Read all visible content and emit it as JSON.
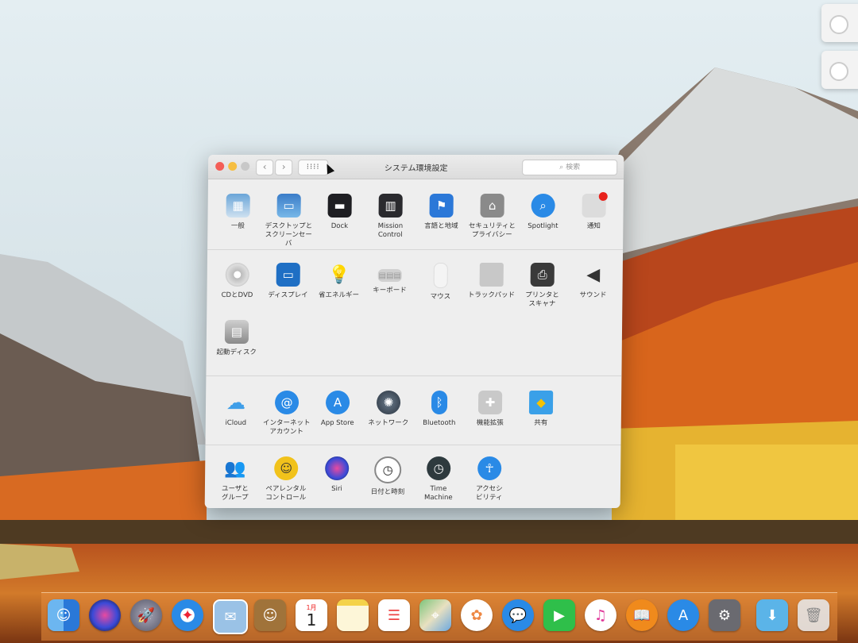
{
  "window": {
    "title": "システム環境設定",
    "search_placeholder": "検索",
    "back_label": "‹",
    "forward_label": "›",
    "grid_label": "⁝⁝⁝⁝"
  },
  "sections": {
    "personal": [
      {
        "label": "一般",
        "icon": "general-icon"
      },
      {
        "label": "デスクトップと\nスクリーンセーバ",
        "icon": "desktop-icon"
      },
      {
        "label": "Dock",
        "icon": "dock-icon"
      },
      {
        "label": "Mission\nControl",
        "icon": "mission-control-icon"
      },
      {
        "label": "言語と地域",
        "icon": "language-icon"
      },
      {
        "label": "セキュリティと\nプライバシー",
        "icon": "security-icon"
      },
      {
        "label": "Spotlight",
        "icon": "spotlight-icon"
      },
      {
        "label": "通知",
        "icon": "notifications-icon"
      }
    ],
    "hardware": [
      {
        "label": "CDとDVD",
        "icon": "cd-dvd-icon"
      },
      {
        "label": "ディスプレイ",
        "icon": "display-icon"
      },
      {
        "label": "省エネルギー",
        "icon": "energy-icon"
      },
      {
        "label": "キーボード",
        "icon": "keyboard-icon"
      },
      {
        "label": "マウス",
        "icon": "mouse-icon"
      },
      {
        "label": "トラックパッド",
        "icon": "trackpad-icon"
      },
      {
        "label": "プリンタと\nスキャナ",
        "icon": "printer-icon"
      },
      {
        "label": "サウンド",
        "icon": "sound-icon"
      },
      {
        "label": "起動ディスク",
        "icon": "startup-disk-icon"
      }
    ],
    "internet": [
      {
        "label": "iCloud",
        "icon": "icloud-icon"
      },
      {
        "label": "インターネット\nアカウント",
        "icon": "internet-accounts-icon"
      },
      {
        "label": "App Store",
        "icon": "app-store-icon"
      },
      {
        "label": "ネットワーク",
        "icon": "network-icon"
      },
      {
        "label": "Bluetooth",
        "icon": "bluetooth-icon"
      },
      {
        "label": "機能拡張",
        "icon": "extensions-icon"
      },
      {
        "label": "共有",
        "icon": "sharing-icon"
      }
    ],
    "system": [
      {
        "label": "ユーザと\nグループ",
        "icon": "users-icon"
      },
      {
        "label": "ペアレンタル\nコントロール",
        "icon": "parental-icon"
      },
      {
        "label": "Siri",
        "icon": "siri-icon"
      },
      {
        "label": "日付と時刻",
        "icon": "date-time-icon"
      },
      {
        "label": "Time\nMachine",
        "icon": "time-machine-icon"
      },
      {
        "label": "アクセシ\nビリティ",
        "icon": "accessibility-icon"
      }
    ]
  },
  "dock": {
    "apps": [
      "finder-icon",
      "siri-icon",
      "launchpad-icon",
      "safari-icon",
      "mail-icon",
      "contacts-icon",
      "calendar-icon",
      "notes-icon",
      "reminders-icon",
      "maps-icon",
      "photos-icon",
      "messages-icon",
      "facetime-icon",
      "itunes-icon",
      "ibooks-icon",
      "app-store-icon",
      "system-preferences-icon",
      "downloads-folder-icon",
      "trash-icon"
    ],
    "calendar_month": "1月",
    "calendar_day": "1"
  },
  "colors": {
    "close": "#f45e57",
    "minimize": "#f6be40",
    "accent_blue": "#2a8ae6"
  }
}
